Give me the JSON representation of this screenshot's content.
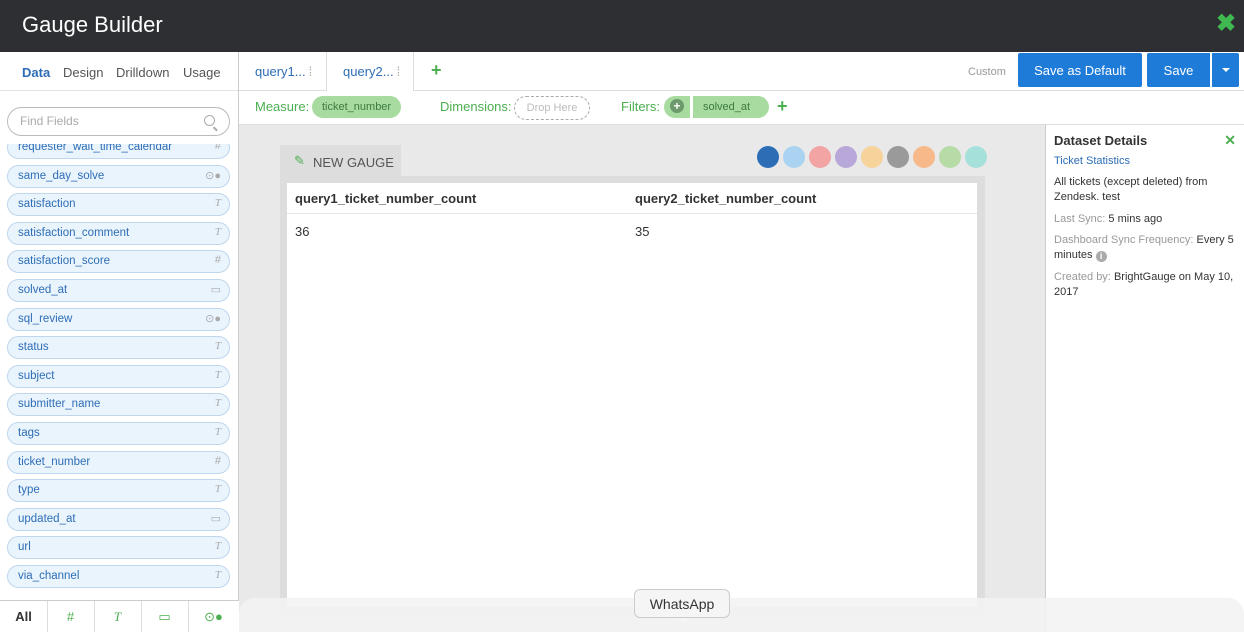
{
  "app": {
    "title": "Gauge Builder"
  },
  "left_tabs": [
    "Data",
    "Design",
    "Drilldown",
    "Usage"
  ],
  "search": {
    "placeholder": "Find Fields"
  },
  "fields": [
    {
      "name": "requester_wait_time_calendar",
      "type": "number"
    },
    {
      "name": "same_day_solve",
      "type": "boolean"
    },
    {
      "name": "satisfaction",
      "type": "text"
    },
    {
      "name": "satisfaction_comment",
      "type": "text"
    },
    {
      "name": "satisfaction_score",
      "type": "number"
    },
    {
      "name": "solved_at",
      "type": "date"
    },
    {
      "name": "sql_review",
      "type": "boolean"
    },
    {
      "name": "status",
      "type": "text"
    },
    {
      "name": "subject",
      "type": "text"
    },
    {
      "name": "submitter_name",
      "type": "text"
    },
    {
      "name": "tags",
      "type": "text"
    },
    {
      "name": "ticket_number",
      "type": "number"
    },
    {
      "name": "type",
      "type": "text"
    },
    {
      "name": "updated_at",
      "type": "date"
    },
    {
      "name": "url",
      "type": "text"
    },
    {
      "name": "via_channel",
      "type": "text"
    }
  ],
  "type_glyphs": {
    "number": "#",
    "text": "T",
    "date": "▭",
    "boolean": "⊙●"
  },
  "bottom_tabs": [
    "All",
    "#",
    "T",
    "▭",
    "⊙●"
  ],
  "query_tabs": [
    "query1...",
    "query2..."
  ],
  "toolbar": {
    "custom_label": "Custom",
    "save_default_label": "Save as Default",
    "save_label": "Save"
  },
  "filterbar": {
    "measure_label": "Measure:",
    "measure_value": "ticket_number",
    "dimensions_label": "Dimensions:",
    "dimensions_placeholder": "Drop Here",
    "filters_label": "Filters:",
    "filter_value": "solved_at"
  },
  "gauge": {
    "name": "NEW GAUGE",
    "columns": [
      "query1_ticket_number_count",
      "query2_ticket_number_count"
    ],
    "rows": [
      [
        "36",
        "35"
      ]
    ],
    "viz_colors": [
      "#2d6db5",
      "#a9d3f0",
      "#f2a3a3",
      "#b8a7d9",
      "#f6d39a",
      "#9a9a9a",
      "#f7b98a",
      "#b6dba7",
      "#a6e0db"
    ],
    "viz_icons": [
      "table-icon",
      "bar-chart-icon",
      "line-chart-icon",
      "stacked-bar-icon",
      "pie-chart-icon",
      "number-icon",
      "gauge-icon",
      "list-icon",
      "trophy-icon"
    ]
  },
  "dataset": {
    "title": "Dataset Details",
    "name": "Ticket Statistics",
    "description": "All tickets (except deleted) from Zendesk. test",
    "last_sync_label": "Last Sync:",
    "last_sync_value": "5 mins ago",
    "frequency_label": "Dashboard Sync Frequency:",
    "frequency_value": "Every 5 minutes",
    "created_label": "Created by:",
    "created_value": "BrightGauge on May 10, 2017"
  },
  "tooltip": {
    "text": "WhatsApp"
  }
}
